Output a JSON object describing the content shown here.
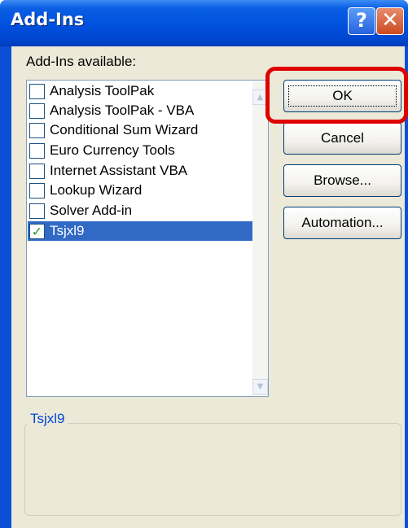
{
  "dialog": {
    "title": "Add-Ins",
    "help_glyph": "?",
    "close_glyph": "✕"
  },
  "list": {
    "label": "Add-Ins available:",
    "items": [
      {
        "label": "Analysis ToolPak",
        "checked": false,
        "mark": ""
      },
      {
        "label": "Analysis ToolPak - VBA",
        "checked": false,
        "mark": ""
      },
      {
        "label": "Conditional Sum Wizard",
        "checked": false,
        "mark": ""
      },
      {
        "label": "Euro Currency Tools",
        "checked": false,
        "mark": ""
      },
      {
        "label": "Internet Assistant VBA",
        "checked": false,
        "mark": ""
      },
      {
        "label": "Lookup Wizard",
        "checked": false,
        "mark": ""
      },
      {
        "label": "Solver Add-in",
        "checked": false,
        "mark": ""
      },
      {
        "label": "Tsjxl9",
        "checked": true,
        "mark": "✓",
        "selected": true
      }
    ],
    "scroll_up_glyph": "▲",
    "scroll_down_glyph": "▼"
  },
  "buttons": {
    "ok": "OK",
    "cancel": "Cancel",
    "browse": "Browse...",
    "automation": "Automation..."
  },
  "description": {
    "title": "Tsjxl9"
  },
  "colors": {
    "title_bar": "#0050de",
    "selection": "#316ac5",
    "highlight_box": "#e00000",
    "group_title": "#0046d5"
  }
}
